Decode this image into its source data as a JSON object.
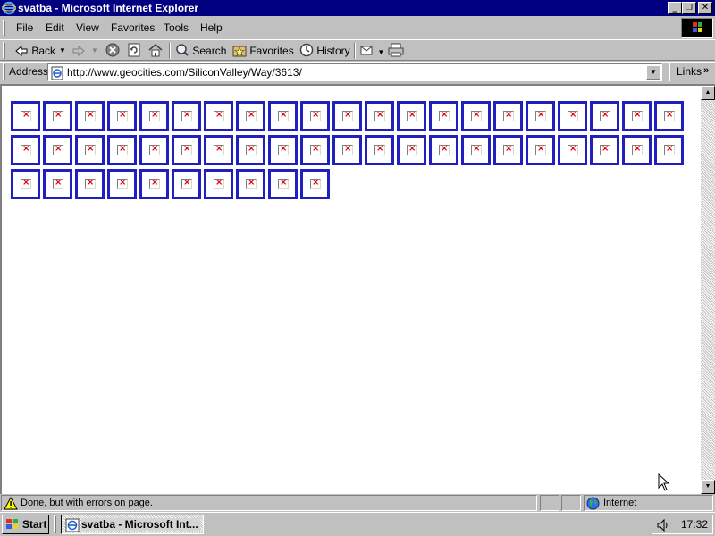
{
  "window": {
    "title": "svatba - Microsoft Internet Explorer",
    "controls": {
      "minimize": "_",
      "maximize": "❐",
      "close": "✕"
    }
  },
  "menu": {
    "items": [
      {
        "label": "File"
      },
      {
        "label": "Edit"
      },
      {
        "label": "View"
      },
      {
        "label": "Favorites"
      },
      {
        "label": "Tools"
      },
      {
        "label": "Help"
      }
    ]
  },
  "toolbar": {
    "back": "Back",
    "search": "Search",
    "favorites": "Favorites",
    "history": "History"
  },
  "address_bar": {
    "label": "Address",
    "url": "http://www.geocities.com/SiliconValley/Way/3613/",
    "links_label": "Links",
    "links_chevron": "»"
  },
  "content": {
    "broken_image_count": 52,
    "broken_image_glyph": "×",
    "frame_color": "#2020c0",
    "broken_mark_color": "#e00000"
  },
  "status_bar": {
    "message": "Done, but with errors on page.",
    "zone": "Internet"
  },
  "taskbar": {
    "start_label": "Start",
    "task_label": "svatba - Microsoft Int...",
    "clock": "17:32"
  },
  "colors": {
    "titlebar": "#000080",
    "chrome": "#c0c0c0"
  }
}
